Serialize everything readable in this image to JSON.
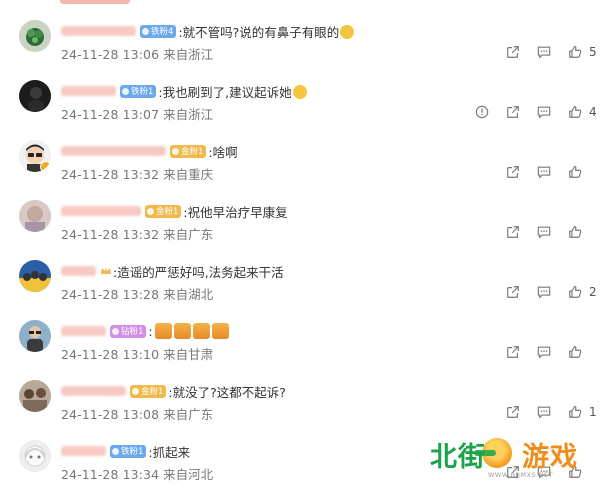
{
  "comments": [
    {
      "id": "c1",
      "name_width": 75,
      "badges": [
        {
          "type": "blue",
          "label": "铁粉4"
        }
      ],
      "text": ":就不管吗?说的有鼻子有眼的",
      "trail_emoji": true,
      "time": "24-11-28 13:06",
      "location": "来自浙江",
      "actions": [
        "forward",
        "comment",
        "like"
      ],
      "likes": "5",
      "avatar": "plant"
    },
    {
      "id": "c2",
      "name_width": 55,
      "badges": [
        {
          "type": "blue",
          "label": "铁粉1"
        }
      ],
      "text": ":我也刷到了,建议起诉她",
      "trail_emoji": true,
      "time": "24-11-28 13:07",
      "location": "来自浙江",
      "actions": [
        "report",
        "forward",
        "comment",
        "like"
      ],
      "likes": "4",
      "avatar": "dark"
    },
    {
      "id": "c3",
      "name_width": 105,
      "badges": [
        {
          "type": "gold",
          "label": "金粉1"
        }
      ],
      "text": ":啥啊",
      "trail_emoji": false,
      "time": "24-11-28 13:32",
      "location": "来自重庆",
      "actions": [
        "forward",
        "comment",
        "like"
      ],
      "likes": "",
      "avatar": "glasses",
      "verified": true
    },
    {
      "id": "c4",
      "name_width": 80,
      "badges": [
        {
          "type": "gold",
          "label": "金粉1"
        }
      ],
      "text": ":祝他早治疗早康复",
      "trail_emoji": false,
      "time": "24-11-28 13:32",
      "location": "来自广东",
      "actions": [
        "forward",
        "comment",
        "like"
      ],
      "likes": "",
      "avatar": "blur"
    },
    {
      "id": "c5",
      "name_width": 35,
      "badges": [
        {
          "type": "crown",
          "label": ""
        }
      ],
      "text": ":造谣的严惩好吗,法务起来干活",
      "trail_emoji": false,
      "time": "24-11-28 13:28",
      "location": "来自湖北",
      "actions": [
        "forward",
        "comment",
        "like"
      ],
      "likes": "2",
      "avatar": "crowd"
    },
    {
      "id": "c6",
      "name_width": 45,
      "badges": [
        {
          "type": "pink",
          "label": "钻粉1"
        }
      ],
      "text": ":",
      "stickers": 4,
      "trail_emoji": false,
      "time": "24-11-28 13:10",
      "location": "来自甘肃",
      "actions": [
        "forward",
        "comment",
        "like"
      ],
      "likes": "",
      "avatar": "person"
    },
    {
      "id": "c7",
      "name_width": 65,
      "badges": [
        {
          "type": "gold",
          "label": "金粉1"
        }
      ],
      "text": ":就没了?这都不起诉?",
      "trail_emoji": false,
      "time": "24-11-28 13:08",
      "location": "来自广东",
      "actions": [
        "forward",
        "comment",
        "like"
      ],
      "likes": "1",
      "avatar": "group"
    },
    {
      "id": "c8",
      "name_width": 45,
      "badges": [
        {
          "type": "blue",
          "label": "铁粉1"
        }
      ],
      "text": ":抓起来",
      "trail_emoji": false,
      "time": "24-11-28 13:34",
      "location": "来自河北",
      "actions": [
        "forward",
        "comment",
        "like"
      ],
      "likes": "",
      "avatar": "anime"
    }
  ],
  "watermark": {
    "part1": "北街",
    "part2": "游戏",
    "url": "WWW.BJJMXS.NET"
  },
  "colors": {
    "accent_blue": "#6aa8f0",
    "gold": "#f2b84b",
    "pink": "#d38fe6",
    "muted": "#777777"
  }
}
